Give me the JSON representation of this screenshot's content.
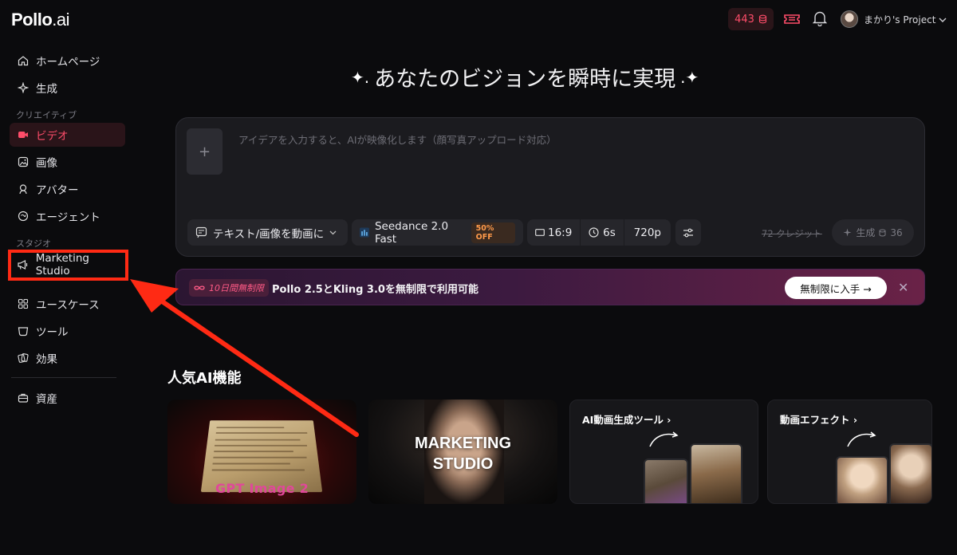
{
  "brand": {
    "name": "Pollo",
    "suffix": ".ai"
  },
  "sidebar": {
    "items_top": [
      {
        "label": "ホームページ",
        "icon": "home-icon"
      },
      {
        "label": "生成",
        "icon": "sparkle-icon"
      }
    ],
    "creative_label": "クリエイティブ",
    "creative_items": [
      {
        "label": "ビデオ",
        "icon": "video-icon",
        "active": true
      },
      {
        "label": "画像",
        "icon": "image-icon"
      },
      {
        "label": "アバター",
        "icon": "avatar-icon"
      },
      {
        "label": "エージェント",
        "icon": "agent-icon"
      }
    ],
    "studio_label": "スタジオ",
    "studio_items": [
      {
        "label": "Marketing Studio",
        "icon": "megaphone-icon"
      }
    ],
    "more_items": [
      {
        "label": "ユースケース",
        "icon": "grid-icon"
      },
      {
        "label": "ツール",
        "icon": "tool-icon"
      },
      {
        "label": "効果",
        "icon": "effects-icon"
      }
    ],
    "assets_item": {
      "label": "資産",
      "icon": "briefcase-icon"
    }
  },
  "topbar": {
    "credits": "443",
    "project": "まかり's Project"
  },
  "hero": {
    "title": "あなたのビジョンを瞬時に実現"
  },
  "prompt": {
    "placeholder": "アイデアを入力すると、AIが映像化します（顔写真アップロード対応）",
    "mode": "テキスト/画像を動画に",
    "model": "Seedance 2.0 Fast",
    "model_badge": "50% OFF",
    "ratio": "16:9",
    "duration": "6s",
    "resolution": "720p",
    "crossed_price": "72 クレジット",
    "generate_label": "生成",
    "generate_cost": "36"
  },
  "banner": {
    "tag": "10日間無制限",
    "text": "Pollo 2.5とKling 3.0を無制限で利用可能",
    "cta": "無制限に入手 →"
  },
  "popular": {
    "title": "人気AI機能",
    "cards": [
      {
        "label": "GPT Image 2"
      },
      {
        "label_line1": "MARKETING",
        "label_line2": "STUDIO"
      },
      {
        "label": "AI動画生成ツール"
      },
      {
        "label": "動画エフェクト"
      }
    ]
  },
  "colors": {
    "accent": "#ff4d6a",
    "annotation": "#ff2a14",
    "background": "#0b0b0d"
  }
}
